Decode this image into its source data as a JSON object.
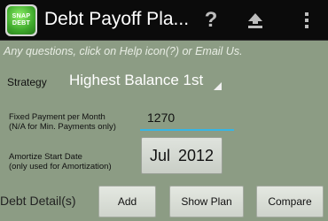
{
  "app": {
    "icon_text": "SNAP DEBT",
    "title": "Debt Payoff Pla..."
  },
  "actionbar": {
    "help_label": "?",
    "upload_icon": "upload-icon",
    "menu_icon": "overflow-menu-icon"
  },
  "info_text": "Any questions, click on Help icon(?) or Email Us.",
  "strategy": {
    "label": "Strategy",
    "selected": "Highest Balance 1st"
  },
  "fixed_payment": {
    "label_line1": "Fixed Payment per Month",
    "label_line2": "(N/A for Min. Payments only)",
    "value": "1270"
  },
  "amortize": {
    "label_line1": "Amortize Start Date",
    "label_line2": "(only used for Amortization)",
    "value": "Jul 2012"
  },
  "bottom": {
    "detail_label": "Debt Detail(s)",
    "add_label": "Add",
    "show_plan_label": "Show Plan",
    "compare_label": "Compare"
  },
  "colors": {
    "background": "#8c9c84",
    "actionbar": "#0b0b0b",
    "input_underline": "#35b5e5",
    "logo_green": "#3ea82b"
  }
}
